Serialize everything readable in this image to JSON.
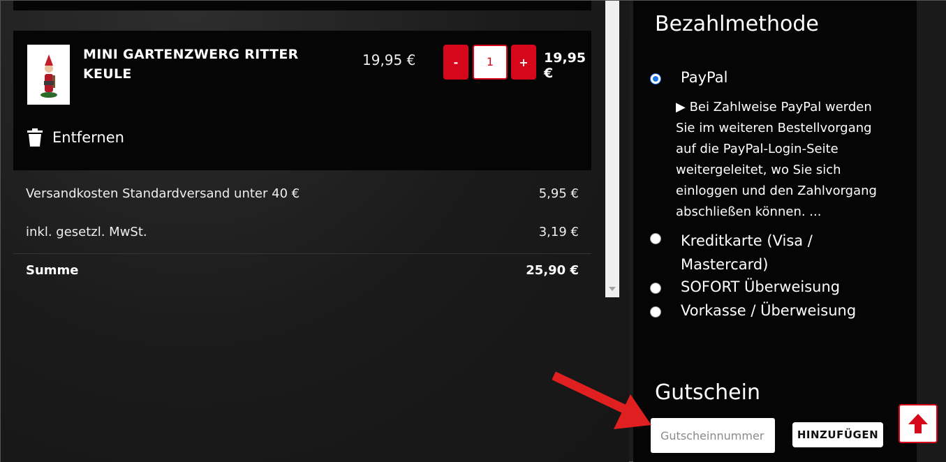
{
  "cart": {
    "item": {
      "name": "MINI GARTENZWERG RITTER KEULE",
      "unit_price": "19,95 €",
      "quantity": "1",
      "total": "19,95 €",
      "minus_label": "-",
      "plus_label": "+",
      "remove_label": "Entfernen"
    },
    "summary": {
      "shipping_label": "Versandkosten Standardversand unter 40 €",
      "shipping_value": "5,95 €",
      "vat_label": "inkl. gesetzl. MwSt.",
      "vat_value": "3,19 €",
      "sum_label": "Summe",
      "sum_value": "25,90 €"
    }
  },
  "payment": {
    "title": "Bezahlmethode",
    "options": [
      {
        "label": "PayPal",
        "selected": true
      },
      {
        "label": "Kreditkarte (Visa / Mastercard)",
        "selected": false
      },
      {
        "label": "SOFORT Überweisung",
        "selected": false
      },
      {
        "label": "Vorkasse / Überweisung",
        "selected": false
      }
    ],
    "paypal_description": "▶ Bei Zahlweise PayPal werden Sie im weiteren Bestellvorgang auf die PayPal-Login-Seite weitergeleitet, wo Sie sich einloggen und den Zahlvorgang abschließen können. ..."
  },
  "voucher": {
    "title": "Gutschein",
    "placeholder": "Gutscheinnummer",
    "button_label": "HINZUFÜGEN"
  },
  "colors": {
    "accent": "#d6071a",
    "panel": "#050505",
    "annotation_arrow": "#e02020"
  }
}
